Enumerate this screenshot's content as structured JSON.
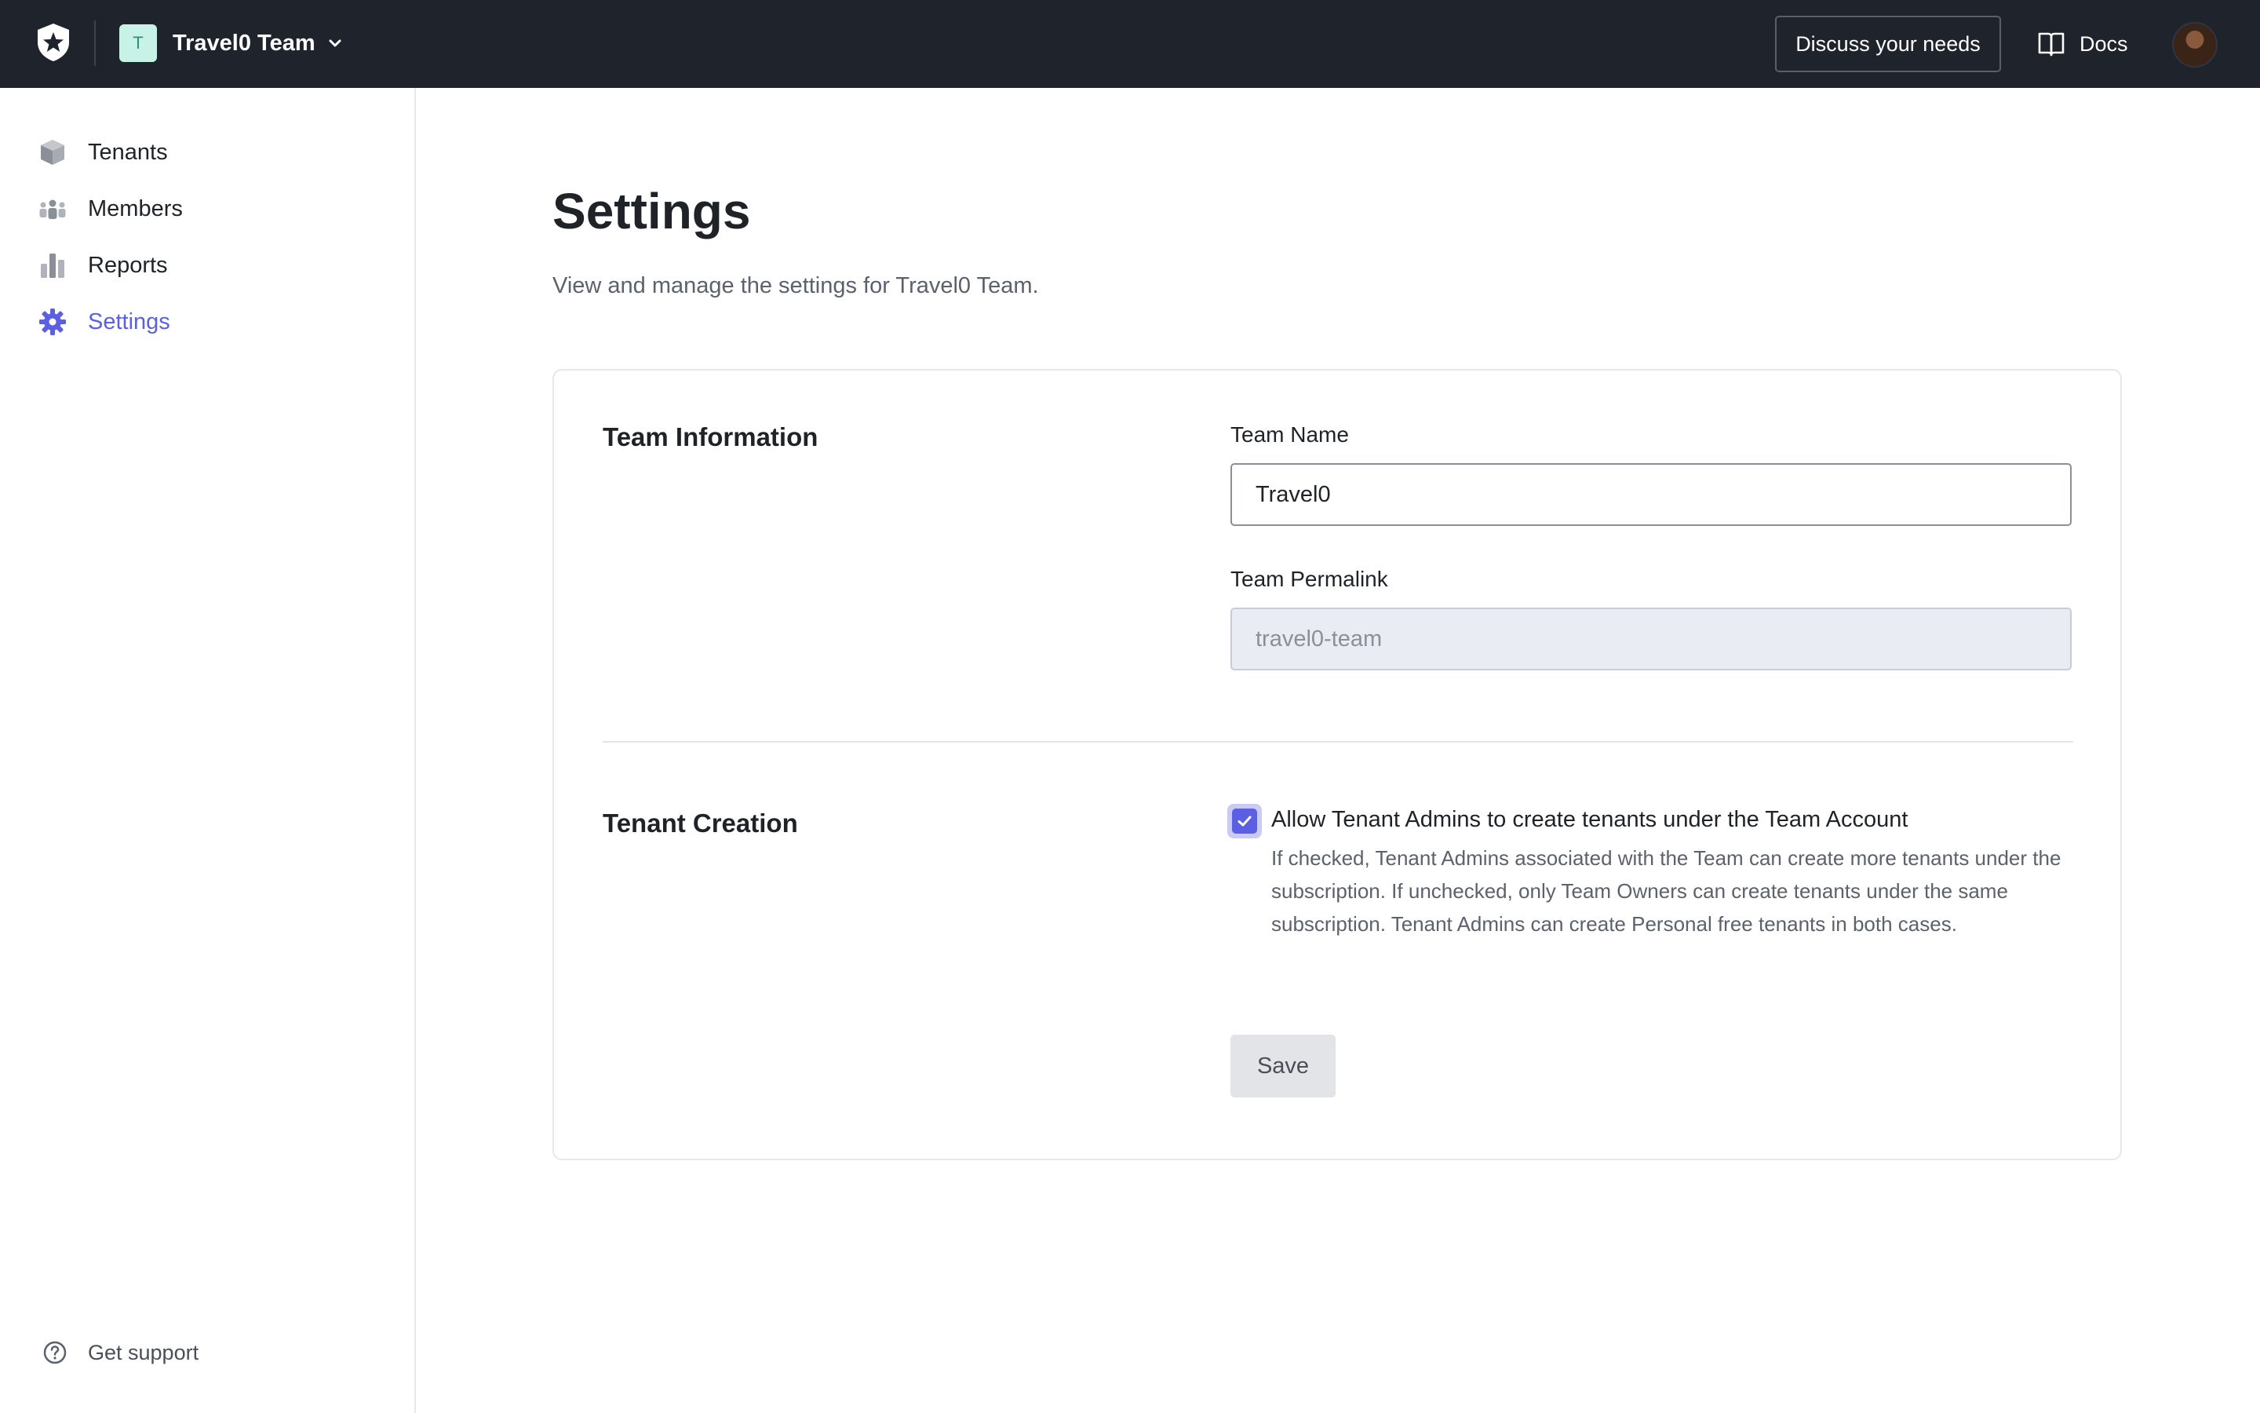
{
  "header": {
    "team_initial": "T",
    "team_name": "Travel0 Team",
    "discuss_label": "Discuss your needs",
    "docs_label": "Docs",
    "icons": [
      "auth0-logo-icon",
      "chevron-down-icon",
      "book-icon",
      "avatar"
    ]
  },
  "sidebar": {
    "items": [
      {
        "label": "Tenants",
        "icon": "cube-icon",
        "active": false
      },
      {
        "label": "Members",
        "icon": "members-icon",
        "active": false
      },
      {
        "label": "Reports",
        "icon": "bar-chart-icon",
        "active": false
      },
      {
        "label": "Settings",
        "icon": "gear-icon",
        "active": true
      }
    ],
    "support_label": "Get support",
    "support_icon": "help-circle-icon"
  },
  "main": {
    "title": "Settings",
    "subtitle": "View and manage the settings for Travel0 Team."
  },
  "team_info": {
    "section_title": "Team Information",
    "name_label": "Team Name",
    "name_value": "Travel0",
    "permalink_label": "Team Permalink",
    "permalink_value": "travel0-team"
  },
  "tenant_creation": {
    "section_title": "Tenant Creation",
    "checkbox_checked": true,
    "checkbox_label": "Allow Tenant Admins to create tenants under the Team Account",
    "help_text": "If checked, Tenant Admins associated with the Team can create more tenants under the subscription. If unchecked, only Team Owners can create tenants under the same subscription. Tenant Admins can create Personal free tenants in both cases."
  },
  "actions": {
    "save_label": "Save"
  },
  "colors": {
    "topbar": "#1f232b",
    "accent": "#5b5fe3",
    "readonly_bg": "#e9ecf3"
  }
}
